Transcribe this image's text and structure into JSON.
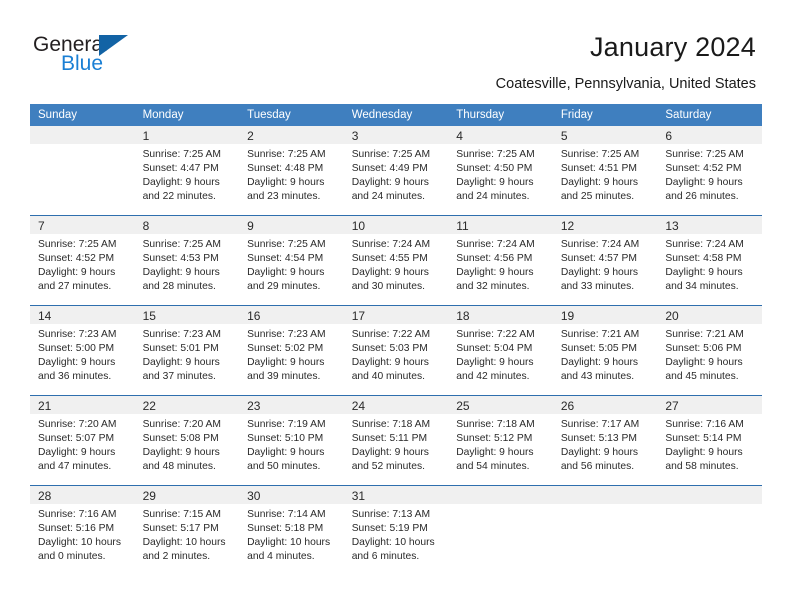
{
  "brand": {
    "name_line1": "General",
    "name_line2": "Blue",
    "accent_color": "#1263a5",
    "text_color": "#1a7fd4"
  },
  "header": {
    "title": "January 2024",
    "location": "Coatesville, Pennsylvania, United States"
  },
  "calendar": {
    "header_bg": "#3f7fbf",
    "row_divider_color": "#2f6fae",
    "daynum_band_bg": "#f0f0f0",
    "weekdays": [
      "Sunday",
      "Monday",
      "Tuesday",
      "Wednesday",
      "Thursday",
      "Friday",
      "Saturday"
    ],
    "weeks": [
      [
        {
          "day": "",
          "lines": []
        },
        {
          "day": "1",
          "lines": [
            "Sunrise: 7:25 AM",
            "Sunset: 4:47 PM",
            "Daylight: 9 hours",
            "and 22 minutes."
          ]
        },
        {
          "day": "2",
          "lines": [
            "Sunrise: 7:25 AM",
            "Sunset: 4:48 PM",
            "Daylight: 9 hours",
            "and 23 minutes."
          ]
        },
        {
          "day": "3",
          "lines": [
            "Sunrise: 7:25 AM",
            "Sunset: 4:49 PM",
            "Daylight: 9 hours",
            "and 24 minutes."
          ]
        },
        {
          "day": "4",
          "lines": [
            "Sunrise: 7:25 AM",
            "Sunset: 4:50 PM",
            "Daylight: 9 hours",
            "and 24 minutes."
          ]
        },
        {
          "day": "5",
          "lines": [
            "Sunrise: 7:25 AM",
            "Sunset: 4:51 PM",
            "Daylight: 9 hours",
            "and 25 minutes."
          ]
        },
        {
          "day": "6",
          "lines": [
            "Sunrise: 7:25 AM",
            "Sunset: 4:52 PM",
            "Daylight: 9 hours",
            "and 26 minutes."
          ]
        }
      ],
      [
        {
          "day": "7",
          "lines": [
            "Sunrise: 7:25 AM",
            "Sunset: 4:52 PM",
            "Daylight: 9 hours",
            "and 27 minutes."
          ]
        },
        {
          "day": "8",
          "lines": [
            "Sunrise: 7:25 AM",
            "Sunset: 4:53 PM",
            "Daylight: 9 hours",
            "and 28 minutes."
          ]
        },
        {
          "day": "9",
          "lines": [
            "Sunrise: 7:25 AM",
            "Sunset: 4:54 PM",
            "Daylight: 9 hours",
            "and 29 minutes."
          ]
        },
        {
          "day": "10",
          "lines": [
            "Sunrise: 7:24 AM",
            "Sunset: 4:55 PM",
            "Daylight: 9 hours",
            "and 30 minutes."
          ]
        },
        {
          "day": "11",
          "lines": [
            "Sunrise: 7:24 AM",
            "Sunset: 4:56 PM",
            "Daylight: 9 hours",
            "and 32 minutes."
          ]
        },
        {
          "day": "12",
          "lines": [
            "Sunrise: 7:24 AM",
            "Sunset: 4:57 PM",
            "Daylight: 9 hours",
            "and 33 minutes."
          ]
        },
        {
          "day": "13",
          "lines": [
            "Sunrise: 7:24 AM",
            "Sunset: 4:58 PM",
            "Daylight: 9 hours",
            "and 34 minutes."
          ]
        }
      ],
      [
        {
          "day": "14",
          "lines": [
            "Sunrise: 7:23 AM",
            "Sunset: 5:00 PM",
            "Daylight: 9 hours",
            "and 36 minutes."
          ]
        },
        {
          "day": "15",
          "lines": [
            "Sunrise: 7:23 AM",
            "Sunset: 5:01 PM",
            "Daylight: 9 hours",
            "and 37 minutes."
          ]
        },
        {
          "day": "16",
          "lines": [
            "Sunrise: 7:23 AM",
            "Sunset: 5:02 PM",
            "Daylight: 9 hours",
            "and 39 minutes."
          ]
        },
        {
          "day": "17",
          "lines": [
            "Sunrise: 7:22 AM",
            "Sunset: 5:03 PM",
            "Daylight: 9 hours",
            "and 40 minutes."
          ]
        },
        {
          "day": "18",
          "lines": [
            "Sunrise: 7:22 AM",
            "Sunset: 5:04 PM",
            "Daylight: 9 hours",
            "and 42 minutes."
          ]
        },
        {
          "day": "19",
          "lines": [
            "Sunrise: 7:21 AM",
            "Sunset: 5:05 PM",
            "Daylight: 9 hours",
            "and 43 minutes."
          ]
        },
        {
          "day": "20",
          "lines": [
            "Sunrise: 7:21 AM",
            "Sunset: 5:06 PM",
            "Daylight: 9 hours",
            "and 45 minutes."
          ]
        }
      ],
      [
        {
          "day": "21",
          "lines": [
            "Sunrise: 7:20 AM",
            "Sunset: 5:07 PM",
            "Daylight: 9 hours",
            "and 47 minutes."
          ]
        },
        {
          "day": "22",
          "lines": [
            "Sunrise: 7:20 AM",
            "Sunset: 5:08 PM",
            "Daylight: 9 hours",
            "and 48 minutes."
          ]
        },
        {
          "day": "23",
          "lines": [
            "Sunrise: 7:19 AM",
            "Sunset: 5:10 PM",
            "Daylight: 9 hours",
            "and 50 minutes."
          ]
        },
        {
          "day": "24",
          "lines": [
            "Sunrise: 7:18 AM",
            "Sunset: 5:11 PM",
            "Daylight: 9 hours",
            "and 52 minutes."
          ]
        },
        {
          "day": "25",
          "lines": [
            "Sunrise: 7:18 AM",
            "Sunset: 5:12 PM",
            "Daylight: 9 hours",
            "and 54 minutes."
          ]
        },
        {
          "day": "26",
          "lines": [
            "Sunrise: 7:17 AM",
            "Sunset: 5:13 PM",
            "Daylight: 9 hours",
            "and 56 minutes."
          ]
        },
        {
          "day": "27",
          "lines": [
            "Sunrise: 7:16 AM",
            "Sunset: 5:14 PM",
            "Daylight: 9 hours",
            "and 58 minutes."
          ]
        }
      ],
      [
        {
          "day": "28",
          "lines": [
            "Sunrise: 7:16 AM",
            "Sunset: 5:16 PM",
            "Daylight: 10 hours",
            "and 0 minutes."
          ]
        },
        {
          "day": "29",
          "lines": [
            "Sunrise: 7:15 AM",
            "Sunset: 5:17 PM",
            "Daylight: 10 hours",
            "and 2 minutes."
          ]
        },
        {
          "day": "30",
          "lines": [
            "Sunrise: 7:14 AM",
            "Sunset: 5:18 PM",
            "Daylight: 10 hours",
            "and 4 minutes."
          ]
        },
        {
          "day": "31",
          "lines": [
            "Sunrise: 7:13 AM",
            "Sunset: 5:19 PM",
            "Daylight: 10 hours",
            "and 6 minutes."
          ]
        },
        {
          "day": "",
          "lines": []
        },
        {
          "day": "",
          "lines": []
        },
        {
          "day": "",
          "lines": []
        }
      ]
    ]
  }
}
